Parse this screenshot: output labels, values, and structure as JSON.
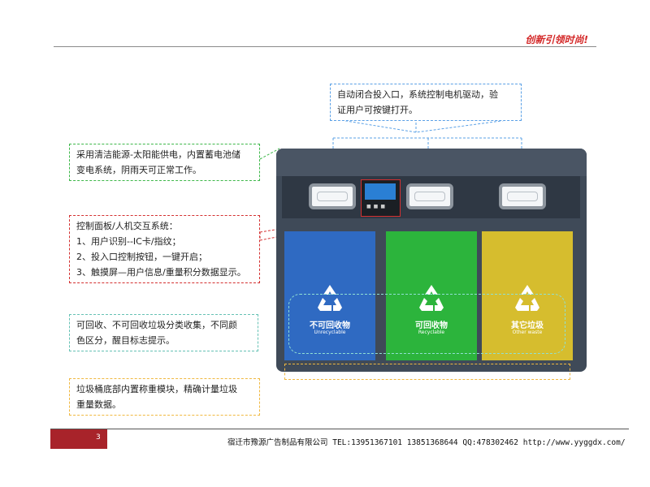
{
  "header": {
    "slogan": "创新引领时尚!"
  },
  "callouts": {
    "top": "自动闭合投入口，系统控制电机驱动，验\n证用户可按键打开。",
    "solar": "采用清洁能源-太阳能供电，内置蓄电池储\n变电系统，阴雨天可正常工作。",
    "panel": "控制面板/人机交互系统：\n1、用户识别--IC卡/指纹；\n2、投入口控制按钮，一键开启；\n3、触摸屏—用户信息/重量积分数据显示。",
    "sort": "可回收、不可回收垃圾分类收集，不同颜\n色区分，醒目标志提示。",
    "weigh": "垃圾桶底部内置称重模块，精确计量垃圾\n重量数据。"
  },
  "bin": {
    "doors": [
      {
        "label": "不可回收物",
        "sub": "Unrecyclable",
        "color": "#2f6ac2"
      },
      {
        "label": "可回收物",
        "sub": "Recyclable",
        "color": "#2cb43c"
      },
      {
        "label": "其它垃圾",
        "sub": "Other waste",
        "color": "#d6bd2e"
      }
    ]
  },
  "footer": {
    "page": "3",
    "company": "宿迁市豫源广告制品有限公司 TEL:13951367101 13851368644 QQ:478302462  http://www.yyggdx.com/"
  }
}
